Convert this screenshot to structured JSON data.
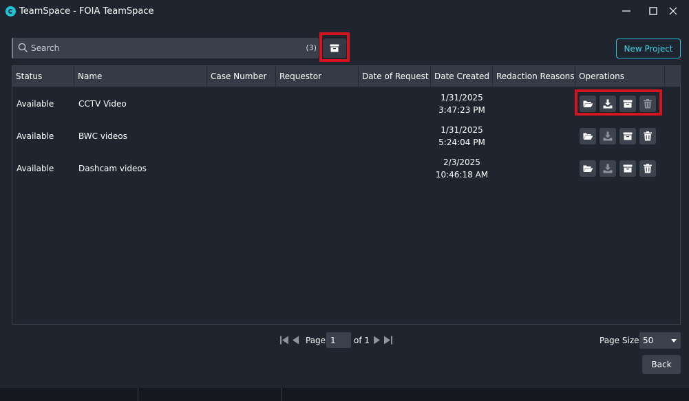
{
  "window": {
    "title": "TeamSpace - FOIA TeamSpace"
  },
  "search": {
    "placeholder": "Search",
    "count": "(3)"
  },
  "toolbar": {
    "new_project_label": "New Project"
  },
  "table": {
    "columns": [
      "Status",
      "Name",
      "Case Number",
      "Requestor",
      "Date of Request",
      "Date Created",
      "Redaction Reasons",
      "Operations"
    ],
    "rows": [
      {
        "status": "Available",
        "name": "CCTV Video",
        "case_number": "",
        "requestor": "",
        "date_of_request": "",
        "date_created_date": "1/31/2025",
        "date_created_time": "3:47:23 PM",
        "redaction_reasons": ""
      },
      {
        "status": "Available",
        "name": "BWC videos",
        "case_number": "",
        "requestor": "",
        "date_of_request": "",
        "date_created_date": "1/31/2025",
        "date_created_time": "5:24:04 PM",
        "redaction_reasons": ""
      },
      {
        "status": "Available",
        "name": "Dashcam videos",
        "case_number": "",
        "requestor": "",
        "date_of_request": "",
        "date_created_date": "2/3/2025",
        "date_created_time": "10:46:18 AM",
        "redaction_reasons": ""
      }
    ],
    "operation_icons": [
      "folder-open-icon",
      "download-icon",
      "archive-icon",
      "trash-icon"
    ]
  },
  "pager": {
    "page_label": "Page",
    "page_value": "1",
    "of_label": "of 1",
    "page_size_label": "Page Size:",
    "page_size_value": "50"
  },
  "footer": {
    "back_label": "Back"
  },
  "colors": {
    "background": "#1f252e",
    "header": "#343b46",
    "accent": "#1fc3d8",
    "highlight": "#d4141f"
  }
}
